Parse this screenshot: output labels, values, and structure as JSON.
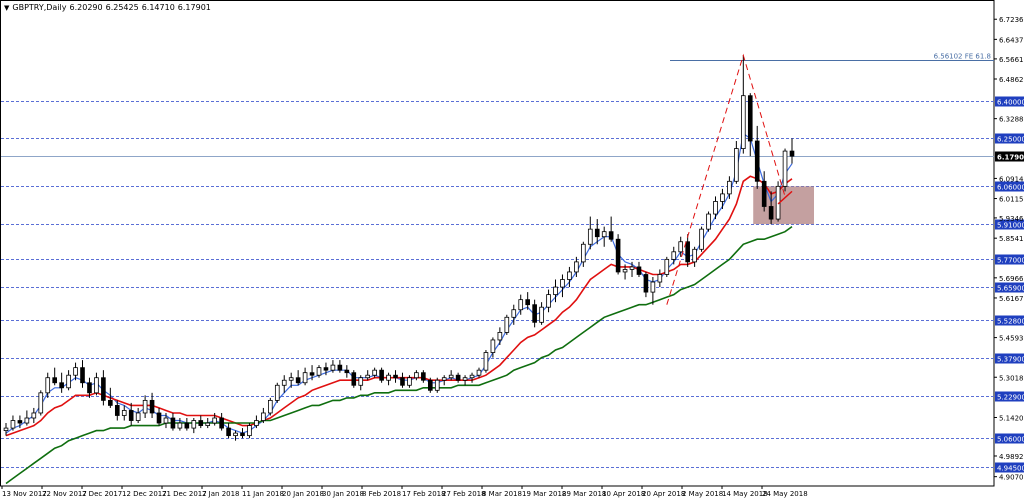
{
  "header": {
    "symbol": "GBPTRY,Daily",
    "open": "6.20290",
    "high": "6.25425",
    "low": "6.14710",
    "close": "6.17901",
    "menu_glyph": "▼"
  },
  "colors": {
    "background": "#ffffff",
    "grid": "#5a6fd6",
    "bull_candle": "#ffffff",
    "bear_candle": "#000000",
    "ema_fast": "#3d6be0",
    "ema_mid": "#e01010",
    "ema_slow": "#0f6e0f",
    "zone_fill": "#b08080",
    "fib_line": "#4a6fa5",
    "projection": "#e01010",
    "level_label_bg": "#1f3fbf",
    "price_label_bg": "#000000"
  },
  "chart_data": {
    "type": "candlestick",
    "symbol": "GBPTRY",
    "timeframe": "Daily",
    "y_axis": {
      "range": [
        4.87,
        6.8
      ],
      "ticks": [
        "6.72360",
        "6.64370",
        "6.56610",
        "6.48625",
        "6.32880",
        "6.09145",
        "6.01155",
        "5.93460",
        "5.85410",
        "5.69665",
        "5.61675",
        "5.45930",
        "5.30185",
        "5.14205",
        "4.98920",
        "4.90705"
      ]
    },
    "x_axis": {
      "ticks": [
        "13 Nov 2017",
        "22 Nov 2017",
        "2 Dec 2017",
        "12 Dec 2017",
        "21 Dec 2017",
        "2 Jan 2018",
        "11 Jan 2018",
        "20 Jan 2018",
        "30 Jan 2018",
        "8 Feb 2018",
        "17 Feb 2018",
        "27 Feb 2018",
        "8 Mar 2018",
        "19 Mar 2018",
        "29 Mar 2018",
        "10 Apr 2018",
        "20 Apr 2018",
        "2 May 2018",
        "14 May 2018",
        "24 May 2018"
      ]
    },
    "horizontal_levels": [
      "6.40000",
      "6.25000",
      "6.06000",
      "5.91000",
      "5.77000",
      "5.65900",
      "5.52800",
      "5.37900",
      "5.22900",
      "5.06000",
      "4.94500"
    ],
    "current_price": "6.17901",
    "fib_annotation": {
      "label": "6.56102 FE 61.8",
      "value": 6.56102
    },
    "zone": {
      "low": 5.91,
      "high": 6.06
    },
    "candles": [
      [
        5.09,
        5.12,
        5.07,
        5.1
      ],
      [
        5.1,
        5.15,
        5.09,
        5.13
      ],
      [
        5.13,
        5.15,
        5.1,
        5.12
      ],
      [
        5.12,
        5.17,
        5.11,
        5.14
      ],
      [
        5.14,
        5.18,
        5.12,
        5.16
      ],
      [
        5.16,
        5.25,
        5.15,
        5.24
      ],
      [
        5.24,
        5.32,
        5.22,
        5.3
      ],
      [
        5.3,
        5.34,
        5.27,
        5.28
      ],
      [
        5.28,
        5.32,
        5.24,
        5.26
      ],
      [
        5.26,
        5.33,
        5.25,
        5.31
      ],
      [
        5.31,
        5.36,
        5.29,
        5.34
      ],
      [
        5.34,
        5.37,
        5.26,
        5.28
      ],
      [
        5.28,
        5.3,
        5.22,
        5.24
      ],
      [
        5.24,
        5.32,
        5.23,
        5.3
      ],
      [
        5.3,
        5.33,
        5.19,
        5.21
      ],
      [
        5.21,
        5.26,
        5.18,
        5.19
      ],
      [
        5.19,
        5.21,
        5.13,
        5.15
      ],
      [
        5.15,
        5.19,
        5.13,
        5.17
      ],
      [
        5.17,
        5.2,
        5.11,
        5.13
      ],
      [
        5.13,
        5.18,
        5.12,
        5.16
      ],
      [
        5.16,
        5.23,
        5.14,
        5.21
      ],
      [
        5.21,
        5.24,
        5.14,
        5.16
      ],
      [
        5.16,
        5.18,
        5.11,
        5.12
      ],
      [
        5.12,
        5.16,
        5.1,
        5.14
      ],
      [
        5.14,
        5.16,
        5.09,
        5.1
      ],
      [
        5.1,
        5.14,
        5.09,
        5.12
      ],
      [
        5.12,
        5.14,
        5.09,
        5.1
      ],
      [
        5.1,
        5.14,
        5.08,
        5.13
      ],
      [
        5.13,
        5.15,
        5.1,
        5.11
      ],
      [
        5.11,
        5.14,
        5.1,
        5.12
      ],
      [
        5.12,
        5.16,
        5.11,
        5.14
      ],
      [
        5.14,
        5.16,
        5.09,
        5.1
      ],
      [
        5.1,
        5.12,
        5.06,
        5.07
      ],
      [
        5.07,
        5.09,
        5.05,
        5.08
      ],
      [
        5.08,
        5.1,
        5.06,
        5.07
      ],
      [
        5.07,
        5.12,
        5.06,
        5.11
      ],
      [
        5.11,
        5.15,
        5.1,
        5.13
      ],
      [
        5.13,
        5.18,
        5.12,
        5.16
      ],
      [
        5.16,
        5.22,
        5.15,
        5.21
      ],
      [
        5.21,
        5.28,
        5.2,
        5.27
      ],
      [
        5.27,
        5.31,
        5.24,
        5.29
      ],
      [
        5.29,
        5.32,
        5.26,
        5.3
      ],
      [
        5.3,
        5.33,
        5.27,
        5.28
      ],
      [
        5.28,
        5.34,
        5.27,
        5.32
      ],
      [
        5.32,
        5.35,
        5.29,
        5.31
      ],
      [
        5.31,
        5.35,
        5.3,
        5.34
      ],
      [
        5.34,
        5.36,
        5.31,
        5.33
      ],
      [
        5.33,
        5.37,
        5.32,
        5.35
      ],
      [
        5.35,
        5.37,
        5.32,
        5.33
      ],
      [
        5.33,
        5.35,
        5.3,
        5.32
      ],
      [
        5.32,
        5.33,
        5.26,
        5.27
      ],
      [
        5.27,
        5.31,
        5.25,
        5.3
      ],
      [
        5.3,
        5.33,
        5.29,
        5.31
      ],
      [
        5.31,
        5.34,
        5.3,
        5.33
      ],
      [
        5.33,
        5.34,
        5.28,
        5.29
      ],
      [
        5.29,
        5.32,
        5.27,
        5.31
      ],
      [
        5.31,
        5.33,
        5.28,
        5.3
      ],
      [
        5.3,
        5.32,
        5.26,
        5.27
      ],
      [
        5.27,
        5.31,
        5.26,
        5.3
      ],
      [
        5.3,
        5.33,
        5.29,
        5.32
      ],
      [
        5.32,
        5.33,
        5.28,
        5.29
      ],
      [
        5.29,
        5.3,
        5.24,
        5.25
      ],
      [
        5.25,
        5.3,
        5.24,
        5.29
      ],
      [
        5.29,
        5.31,
        5.27,
        5.3
      ],
      [
        5.3,
        5.33,
        5.29,
        5.31
      ],
      [
        5.31,
        5.32,
        5.28,
        5.29
      ],
      [
        5.29,
        5.31,
        5.27,
        5.3
      ],
      [
        5.3,
        5.32,
        5.28,
        5.31
      ],
      [
        5.31,
        5.34,
        5.3,
        5.33
      ],
      [
        5.33,
        5.41,
        5.32,
        5.4
      ],
      [
        5.4,
        5.46,
        5.38,
        5.45
      ],
      [
        5.45,
        5.5,
        5.43,
        5.48
      ],
      [
        5.48,
        5.55,
        5.47,
        5.54
      ],
      [
        5.54,
        5.59,
        5.51,
        5.57
      ],
      [
        5.57,
        5.63,
        5.55,
        5.61
      ],
      [
        5.61,
        5.64,
        5.57,
        5.59
      ],
      [
        5.59,
        5.61,
        5.5,
        5.52
      ],
      [
        5.52,
        5.6,
        5.51,
        5.58
      ],
      [
        5.58,
        5.65,
        5.56,
        5.63
      ],
      [
        5.63,
        5.69,
        5.6,
        5.66
      ],
      [
        5.66,
        5.71,
        5.62,
        5.69
      ],
      [
        5.69,
        5.74,
        5.66,
        5.72
      ],
      [
        5.72,
        5.78,
        5.7,
        5.76
      ],
      [
        5.76,
        5.84,
        5.74,
        5.83
      ],
      [
        5.83,
        5.94,
        5.81,
        5.89
      ],
      [
        5.89,
        5.93,
        5.83,
        5.86
      ],
      [
        5.86,
        5.9,
        5.82,
        5.88
      ],
      [
        5.88,
        5.94,
        5.84,
        5.85
      ],
      [
        5.85,
        5.87,
        5.71,
        5.72
      ],
      [
        5.72,
        5.75,
        5.69,
        5.73
      ],
      [
        5.73,
        5.76,
        5.7,
        5.74
      ],
      [
        5.74,
        5.76,
        5.7,
        5.71
      ],
      [
        5.71,
        5.72,
        5.62,
        5.64
      ],
      [
        5.64,
        5.7,
        5.59,
        5.68
      ],
      [
        5.68,
        5.73,
        5.66,
        5.71
      ],
      [
        5.71,
        5.78,
        5.7,
        5.77
      ],
      [
        5.77,
        5.82,
        5.75,
        5.8
      ],
      [
        5.8,
        5.86,
        5.78,
        5.84
      ],
      [
        5.84,
        5.87,
        5.74,
        5.76
      ],
      [
        5.76,
        5.82,
        5.74,
        5.81
      ],
      [
        5.81,
        5.9,
        5.8,
        5.89
      ],
      [
        5.89,
        5.96,
        5.88,
        5.95
      ],
      [
        5.95,
        6.02,
        5.93,
        6.0
      ],
      [
        6.0,
        6.05,
        5.97,
        6.03
      ],
      [
        6.03,
        6.1,
        6.01,
        6.08
      ],
      [
        6.08,
        6.24,
        6.07,
        6.21
      ],
      [
        6.21,
        6.58,
        6.19,
        6.42
      ],
      [
        6.42,
        6.43,
        6.18,
        6.24
      ],
      [
        6.24,
        6.3,
        6.05,
        6.08
      ],
      [
        6.08,
        6.12,
        5.96,
        5.98
      ],
      [
        5.98,
        6.04,
        5.91,
        5.93
      ],
      [
        5.93,
        6.08,
        5.92,
        6.06
      ],
      [
        6.06,
        6.21,
        6.04,
        6.2
      ],
      [
        6.2,
        6.25,
        6.15,
        6.18
      ]
    ],
    "series": [
      {
        "values": [
          5.08,
          5.1,
          5.11,
          5.13,
          5.15,
          5.19,
          5.24,
          5.26,
          5.26,
          5.28,
          5.3,
          5.29,
          5.27,
          5.28,
          5.25,
          5.23,
          5.2,
          5.19,
          5.17,
          5.16,
          5.18,
          5.17,
          5.15,
          5.15,
          5.13,
          5.13,
          5.12,
          5.12,
          5.12,
          5.12,
          5.13,
          5.12,
          5.1,
          5.09,
          5.08,
          5.09,
          5.11,
          5.13,
          5.16,
          5.21,
          5.24,
          5.27,
          5.27,
          5.29,
          5.3,
          5.31,
          5.32,
          5.33,
          5.33,
          5.33,
          5.3,
          5.3,
          5.3,
          5.31,
          5.3,
          5.3,
          5.3,
          5.29,
          5.29,
          5.3,
          5.3,
          5.28,
          5.28,
          5.29,
          5.3,
          5.29,
          5.29,
          5.3,
          5.31,
          5.35,
          5.4,
          5.44,
          5.49,
          5.53,
          5.57,
          5.58,
          5.55,
          5.56,
          5.59,
          5.62,
          5.65,
          5.68,
          5.72,
          5.77,
          5.82,
          5.84,
          5.86,
          5.86,
          5.79,
          5.76,
          5.75,
          5.73,
          5.69,
          5.68,
          5.69,
          5.73,
          5.76,
          5.8,
          5.78,
          5.79,
          5.84,
          5.89,
          5.94,
          5.98,
          6.03,
          6.12,
          6.27,
          6.25,
          6.16,
          6.07,
          6.0,
          6.03,
          6.11,
          6.15
        ]
      },
      {
        "values": [
          5.07,
          5.08,
          5.09,
          5.1,
          5.11,
          5.13,
          5.16,
          5.18,
          5.19,
          5.21,
          5.23,
          5.23,
          5.23,
          5.24,
          5.23,
          5.22,
          5.21,
          5.2,
          5.19,
          5.19,
          5.19,
          5.19,
          5.18,
          5.17,
          5.16,
          5.16,
          5.15,
          5.15,
          5.15,
          5.15,
          5.15,
          5.14,
          5.13,
          5.12,
          5.11,
          5.11,
          5.12,
          5.13,
          5.14,
          5.16,
          5.18,
          5.2,
          5.22,
          5.23,
          5.25,
          5.26,
          5.27,
          5.28,
          5.29,
          5.29,
          5.29,
          5.29,
          5.29,
          5.3,
          5.3,
          5.3,
          5.3,
          5.3,
          5.3,
          5.3,
          5.3,
          5.29,
          5.29,
          5.29,
          5.29,
          5.29,
          5.29,
          5.29,
          5.3,
          5.31,
          5.33,
          5.35,
          5.38,
          5.41,
          5.44,
          5.46,
          5.47,
          5.49,
          5.51,
          5.53,
          5.56,
          5.58,
          5.61,
          5.65,
          5.69,
          5.71,
          5.73,
          5.75,
          5.74,
          5.74,
          5.74,
          5.73,
          5.72,
          5.71,
          5.71,
          5.72,
          5.73,
          5.75,
          5.75,
          5.76,
          5.79,
          5.82,
          5.85,
          5.89,
          5.93,
          5.99,
          6.08,
          6.1,
          6.09,
          6.07,
          6.03,
          6.04,
          6.07,
          6.09
        ]
      },
      {
        "values": [
          4.88,
          4.9,
          4.92,
          4.94,
          4.96,
          4.98,
          5.0,
          5.02,
          5.03,
          5.05,
          5.06,
          5.07,
          5.08,
          5.09,
          5.09,
          5.1,
          5.1,
          5.1,
          5.11,
          5.11,
          5.11,
          5.11,
          5.11,
          5.12,
          5.12,
          5.12,
          5.12,
          5.12,
          5.12,
          5.12,
          5.12,
          5.12,
          5.12,
          5.12,
          5.12,
          5.12,
          5.12,
          5.13,
          5.13,
          5.14,
          5.15,
          5.16,
          5.17,
          5.18,
          5.19,
          5.19,
          5.2,
          5.21,
          5.21,
          5.22,
          5.22,
          5.23,
          5.23,
          5.24,
          5.24,
          5.24,
          5.25,
          5.25,
          5.25,
          5.25,
          5.26,
          5.26,
          5.26,
          5.26,
          5.26,
          5.27,
          5.27,
          5.27,
          5.27,
          5.28,
          5.29,
          5.3,
          5.31,
          5.33,
          5.34,
          5.35,
          5.36,
          5.38,
          5.39,
          5.41,
          5.42,
          5.44,
          5.46,
          5.48,
          5.5,
          5.52,
          5.54,
          5.55,
          5.56,
          5.57,
          5.58,
          5.59,
          5.59,
          5.6,
          5.61,
          5.62,
          5.63,
          5.65,
          5.66,
          5.67,
          5.69,
          5.71,
          5.73,
          5.75,
          5.77,
          5.8,
          5.83,
          5.84,
          5.85,
          5.85,
          5.86,
          5.87,
          5.88,
          5.9
        ]
      }
    ],
    "projection": [
      [
        95,
        5.59
      ],
      [
        106,
        6.58
      ],
      [
        112,
        6.02
      ]
    ],
    "trend_line": [
      [
        111,
        5.99
      ],
      [
        113,
        6.04
      ]
    ]
  }
}
